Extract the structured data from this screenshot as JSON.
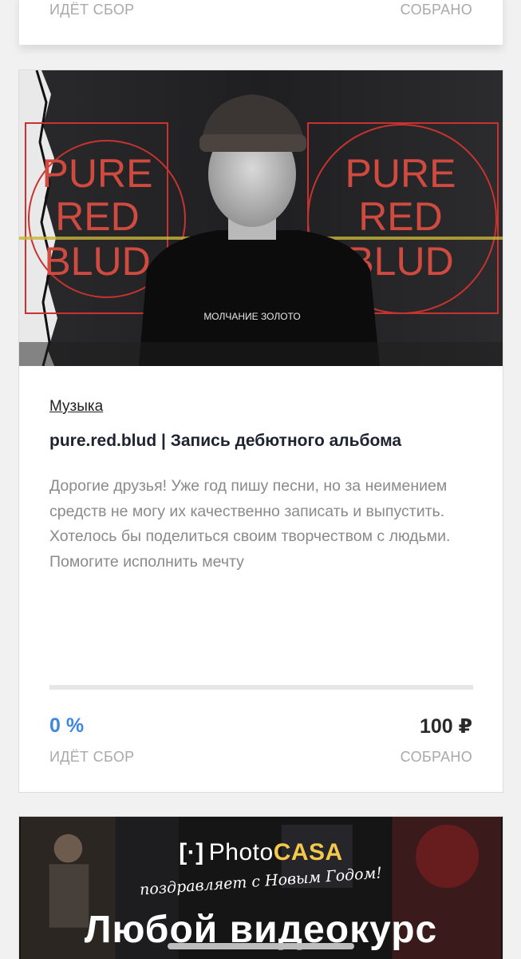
{
  "card_prev": {
    "status_label": "ИДЁТ СБОР",
    "collected_label": "СОБРАНО"
  },
  "campaign": {
    "cover_text": {
      "left_logo": [
        "PURE",
        "RED",
        "BLUD"
      ],
      "right_logo": [
        "PURE",
        "RED",
        "BLUD"
      ],
      "shirt_text": "МОЛЧАНИЕ ЗОЛОТО"
    },
    "category": "Музыка",
    "title": "pure.red.blud | Запись дебютного альбома",
    "description": "Дорогие друзья! Уже год пишу песни, но за неимением средств не могу их качественно записать и выпустить. Хотелось бы поделиться своим творчеством с людьми. Помогите исполнить мечту",
    "progress_fraction": 0,
    "percent": "0 %",
    "amount": "100 ₽",
    "status_label": "ИДЁТ СБОР",
    "collected_label": "СОБРАНО",
    "colors": {
      "accent": "#3d86e4",
      "logo_red": "#c8332f"
    }
  },
  "banner": {
    "bracket": "[·]",
    "brand_photo": "Photo",
    "brand_casa": "CASA",
    "greeting": "поздравляет с Новым Годом!",
    "headline": "Любой видеокурс"
  }
}
